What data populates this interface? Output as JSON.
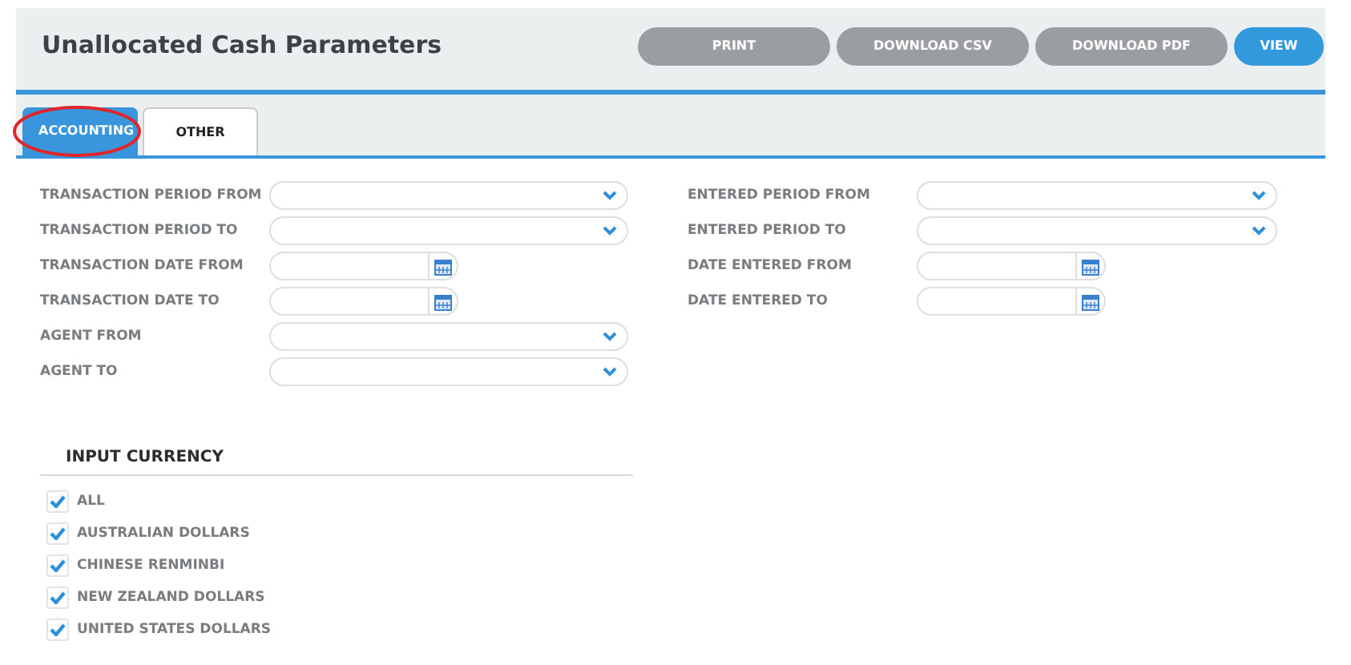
{
  "page": {
    "title": "Unallocated Cash Parameters"
  },
  "buttons": [
    {
      "label": "PRINT",
      "kind": "secondary"
    },
    {
      "label": "DOWNLOAD CSV",
      "kind": "secondary"
    },
    {
      "label": "DOWNLOAD PDF",
      "kind": "secondary"
    },
    {
      "label": "VIEW",
      "kind": "primary"
    }
  ],
  "tabs": [
    {
      "label": "ACCOUNTING",
      "selected": true,
      "circled": true
    },
    {
      "label": "OTHER",
      "selected": false,
      "circled": false
    }
  ],
  "left_fields": [
    {
      "label": "TRANSACTION PERIOD FROM",
      "kind": "select"
    },
    {
      "label": "TRANSACTION PERIOD TO",
      "kind": "select"
    },
    {
      "label": "TRANSACTION DATE FROM",
      "kind": "date"
    },
    {
      "label": "TRANSACTION DATE TO",
      "kind": "date"
    },
    {
      "label": "AGENT FROM",
      "kind": "select"
    },
    {
      "label": "AGENT TO",
      "kind": "select"
    }
  ],
  "right_fields": [
    {
      "label": "ENTERED PERIOD FROM",
      "kind": "select"
    },
    {
      "label": "ENTERED PERIOD TO",
      "kind": "select"
    },
    {
      "label": "DATE ENTERED FROM",
      "kind": "date"
    },
    {
      "label": "DATE ENTERED TO",
      "kind": "date"
    }
  ],
  "currency": {
    "heading": "INPUT CURRENCY",
    "options": [
      {
        "label": "ALL",
        "checked": true
      },
      {
        "label": "AUSTRALIAN DOLLARS",
        "checked": true
      },
      {
        "label": "CHINESE RENMINBI",
        "checked": true
      },
      {
        "label": "NEW ZEALAND DOLLARS",
        "checked": true
      },
      {
        "label": "UNITED STATES DOLLARS",
        "checked": true
      }
    ]
  }
}
